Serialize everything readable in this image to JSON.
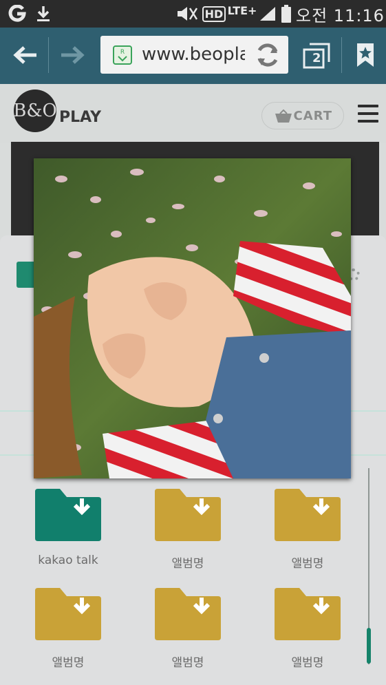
{
  "status_bar": {
    "carrier_icon": "g-logo-icon",
    "download_icon": "download-icon",
    "mute_icon": "mute-icon",
    "hd_badge": "HD",
    "network": "LTE+",
    "signal_icon": "signal-icon",
    "battery_icon": "battery-icon",
    "time": "오전 11:16"
  },
  "browser": {
    "back_icon": "back-arrow-icon",
    "forward_icon": "forward-arrow-icon",
    "url": "www.beopla",
    "reload_icon": "reload-icon",
    "tabs_count": "2",
    "bookmark_icon": "bookmark-star-icon"
  },
  "site": {
    "logo_text": "B&O",
    "brand_suffix": "PLAY",
    "cart_label": "CART",
    "menu_icon": "hamburger-menu-icon"
  },
  "picker": {
    "folders": [
      {
        "label": "kakao talk",
        "color": "#117f6c"
      },
      {
        "label": "앨범명",
        "color": "#c9a237"
      },
      {
        "label": "앨범명",
        "color": "#c9a237"
      },
      {
        "label": "앨범명",
        "color": "#c9a237"
      },
      {
        "label": "앨범명",
        "color": "#c9a237"
      },
      {
        "label": "앨범명",
        "color": "#c9a237"
      }
    ]
  },
  "colors": {
    "status_bar": "#2b2b2b",
    "url_bar": "#2f5f70",
    "accent_green": "#117f6c",
    "folder_gold": "#c9a237"
  },
  "photo": {
    "subject": "girl-lying-in-grass-photo"
  }
}
